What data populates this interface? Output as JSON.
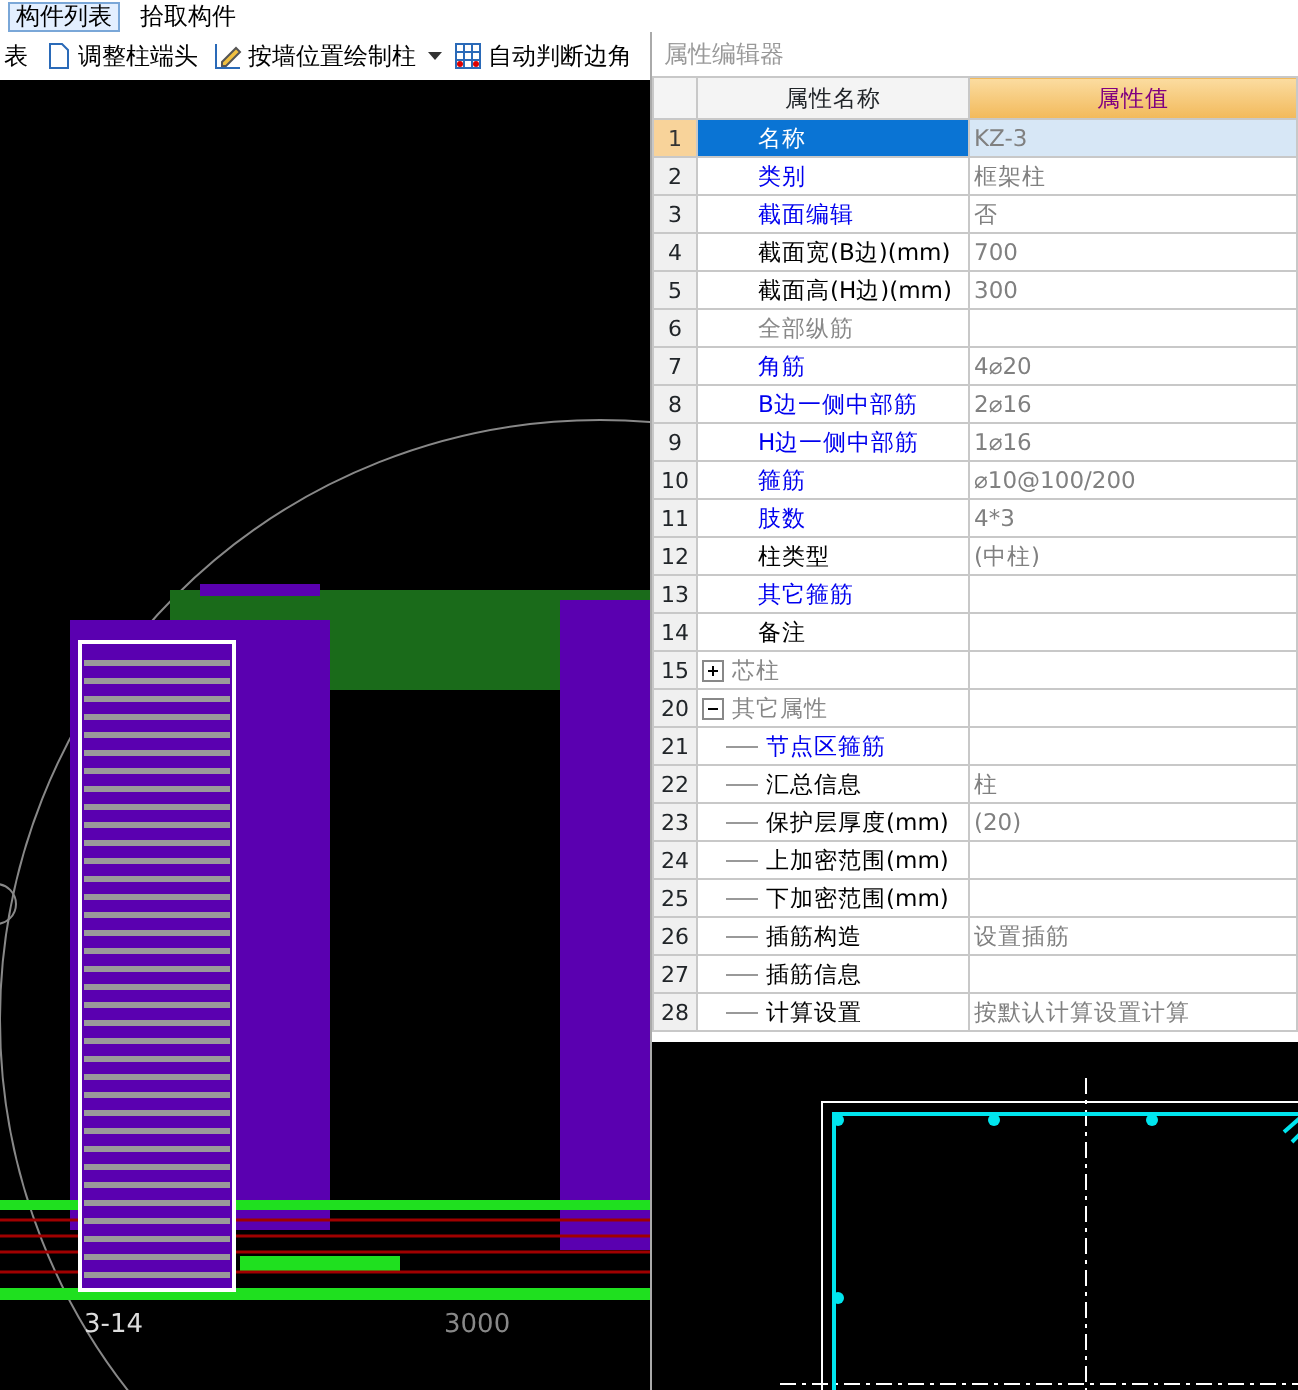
{
  "toolbar_row_1": [
    {
      "label": "构件列表",
      "selected": true
    },
    {
      "label": "拾取构件",
      "selected": false
    }
  ],
  "toolbar_row_2": [
    {
      "label": "表"
    },
    {
      "label": "调整柱端头"
    },
    {
      "label": "按墙位置绘制柱"
    },
    {
      "label": "自动判断边角"
    }
  ],
  "canvas": {
    "dimension_label": "3000",
    "axis_label": "3-14"
  },
  "property_editor": {
    "title": "属性编辑器",
    "columns": [
      "属性名称",
      "属性值"
    ],
    "rows": [
      {
        "num": "1",
        "name": "名称",
        "value": "KZ-3",
        "kind": "link",
        "selected": true
      },
      {
        "num": "2",
        "name": "类别",
        "value": "框架柱",
        "kind": "link",
        "selected": false
      },
      {
        "num": "3",
        "name": "截面编辑",
        "value": "否",
        "kind": "link",
        "selected": false
      },
      {
        "num": "4",
        "name": "截面宽(B边)(mm)",
        "value": "700",
        "kind": "normal",
        "selected": false
      },
      {
        "num": "5",
        "name": "截面高(H边)(mm)",
        "value": "300",
        "kind": "normal",
        "selected": false
      },
      {
        "num": "6",
        "name": "全部纵筋",
        "kind": "muted",
        "selected": false
      },
      {
        "num": "7",
        "name": "角筋",
        "value": "4⌀20",
        "kind": "link",
        "selected": false
      },
      {
        "num": "8",
        "name": "B边一侧中部筋",
        "value": "2⌀16",
        "kind": "link",
        "selected": false
      },
      {
        "num": "9",
        "name": "H边一侧中部筋",
        "value": "1⌀16",
        "kind": "link",
        "selected": false
      },
      {
        "num": "10",
        "name": "箍筋",
        "value": "⌀10@100/200",
        "kind": "link",
        "selected": false
      },
      {
        "num": "11",
        "name": "肢数",
        "value": "4*3",
        "kind": "link",
        "selected": false
      },
      {
        "num": "12",
        "name": "柱类型",
        "value": "(中柱)",
        "kind": "normal",
        "selected": false
      },
      {
        "num": "13",
        "name": "其它箍筋",
        "kind": "link",
        "selected": false
      },
      {
        "num": "14",
        "name": "备注",
        "kind": "normal",
        "selected": false
      },
      {
        "num": "15",
        "name": "芯柱",
        "kind": "muted",
        "selected": false,
        "expanded": false
      },
      {
        "num": "20",
        "name": "其它属性",
        "kind": "muted",
        "selected": false,
        "expanded": true,
        "children": [
          {
            "num": "21",
            "name": "节点区箍筋",
            "kind": "link",
            "selected": false
          },
          {
            "num": "22",
            "name": "汇总信息",
            "value": "柱",
            "kind": "normal",
            "selected": false
          },
          {
            "num": "23",
            "name": "保护层厚度(mm)",
            "value": "(20)",
            "kind": "normal",
            "selected": false
          },
          {
            "num": "24",
            "name": "上加密范围(mm)",
            "kind": "normal",
            "selected": false
          },
          {
            "num": "25",
            "name": "下加密范围(mm)",
            "kind": "normal",
            "selected": false
          },
          {
            "num": "26",
            "name": "插筋构造",
            "value": "设置插筋",
            "kind": "normal",
            "selected": false
          },
          {
            "num": "27",
            "name": "插筋信息",
            "kind": "normal",
            "selected": false
          },
          {
            "num": "28",
            "name": "计算设置",
            "value": "按默认计算设置计算",
            "kind": "normal",
            "selected": false
          }
        ]
      }
    ]
  }
}
